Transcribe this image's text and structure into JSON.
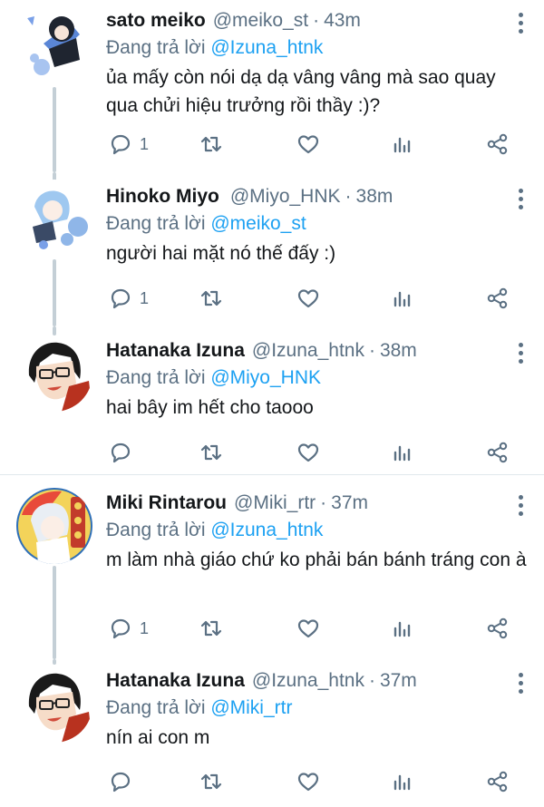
{
  "tweets": [
    {
      "name": "sato meiko",
      "handle": "@meiko_st",
      "time": "43m",
      "reply_prefix": "Đang trả lời",
      "reply_to": "@Izuna_htnk",
      "text": "ủa mấy còn nói dạ dạ vâng vâng mà sao quay qua chửi hiệu trưởng rồi thầy :)?",
      "reply_count": "1"
    },
    {
      "name": "Hinoko Miyo",
      "handle": "@Miyo_HNK",
      "time": "38m",
      "reply_prefix": "Đang trả lời",
      "reply_to": "@meiko_st",
      "text": "người hai mặt nó thế đấy :)",
      "reply_count": "1"
    },
    {
      "name": "Hatanaka Izuna",
      "handle": "@Izuna_htnk",
      "time": "38m",
      "reply_prefix": "Đang trả lời",
      "reply_to": "@Miyo_HNK",
      "text": "hai bây im hết cho taooo",
      "reply_count": ""
    },
    {
      "name": "Miki Rintarou",
      "handle": "@Miki_rtr",
      "time": "37m",
      "reply_prefix": "Đang trả lời",
      "reply_to": "@Izuna_htnk",
      "text": "m làm nhà giáo chứ ko phải bán bánh tráng con à",
      "reply_count": "1"
    },
    {
      "name": "Hatanaka Izuna",
      "handle": "@Izuna_htnk",
      "time": "37m",
      "reply_prefix": "Đang trả lời",
      "reply_to": "@Miki_rtr",
      "text": "nín ai con m",
      "reply_count": ""
    }
  ],
  "action_icons": [
    "reply-icon",
    "retweet-icon",
    "like-icon",
    "analytics-icon",
    "share-icon"
  ],
  "colors": {
    "link": "#1da1f2",
    "muted": "#5b7083",
    "thread_line": "#c4cfd6",
    "separator": "#e1e8ed"
  }
}
